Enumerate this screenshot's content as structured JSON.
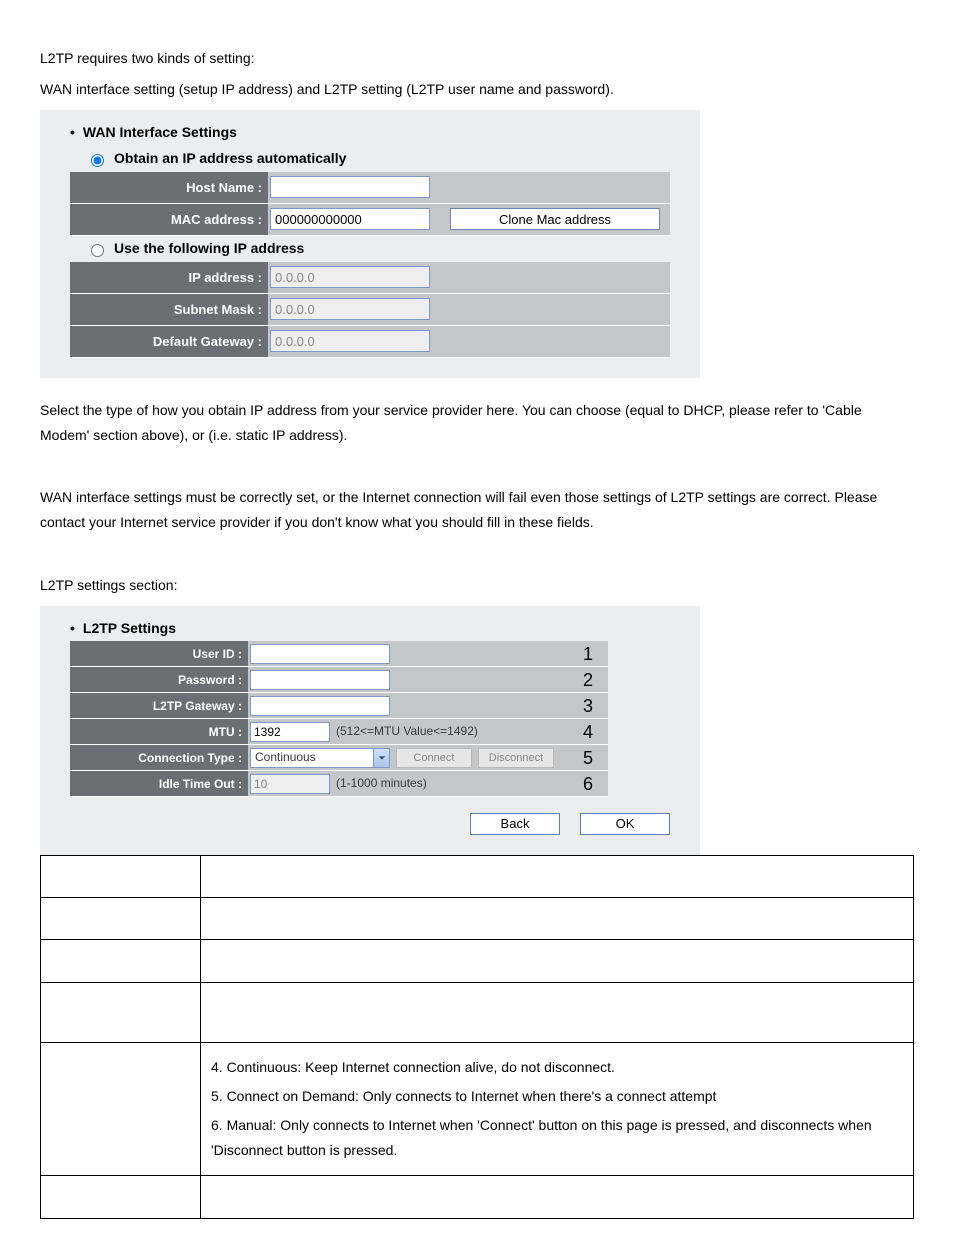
{
  "intro": {
    "line1": "L2TP requires two kinds of setting:",
    "line2": "WAN interface setting (setup IP address) and L2TP setting (L2TP user name and password)."
  },
  "wan": {
    "heading": "WAN Interface Settings",
    "opt_auto": "Obtain an IP address automatically",
    "opt_static": "Use the following IP address",
    "host_label": "Host Name :",
    "host_val": "",
    "mac_label": "MAC address :",
    "mac_val": "000000000000",
    "clone_btn": "Clone Mac address",
    "ip_label": "IP address :",
    "ip_val": "0.0.0.0",
    "mask_label": "Subnet Mask :",
    "mask_val": "0.0.0.0",
    "gw_label": "Default Gateway :",
    "gw_val": "0.0.0.0"
  },
  "mid": {
    "p1a": "Select the type of how you obtain IP address from your service provider here. You can choose",
    "p1b": " (equal to DHCP, please refer to 'Cable Modem' section above), or ",
    "p1c": " (i.e. static IP address).",
    "p2": "WAN interface settings must be correctly set, or the Internet connection will fail even those settings of L2TP settings are correct. Please contact your Internet service provider if you don't know what you should fill in these fields.",
    "p3": "L2TP settings section:"
  },
  "l2tp": {
    "heading": "L2TP Settings",
    "user_label": "User ID :",
    "user_val": "",
    "n1": "1",
    "pass_label": "Password :",
    "pass_val": "",
    "n2": "2",
    "gw_label": "L2TP Gateway :",
    "gw_val": "",
    "n3": "3",
    "mtu_label": "MTU :",
    "mtu_val": "1392",
    "mtu_hint": "(512<=MTU Value<=1492)",
    "n4": "4",
    "ct_label": "Connection Type :",
    "ct_val": "Continuous",
    "connect": "Connect",
    "disconnect": "Disconnect",
    "n5": "5",
    "idle_label": "Idle Time Out :",
    "idle_val": "10",
    "idle_hint": "(1-1000 minutes)",
    "n6": "6",
    "back": "Back",
    "ok": "OK"
  },
  "ref": {
    "r5a": "4.  Continuous: Keep Internet connection alive, do not disconnect.",
    "r5b": "5.  Connect on Demand: Only connects to Internet when there's a connect attempt",
    "r5c": "6.  Manual: Only connects to Internet when 'Connect' button on this page is pressed, and disconnects when 'Disconnect button is pressed."
  }
}
